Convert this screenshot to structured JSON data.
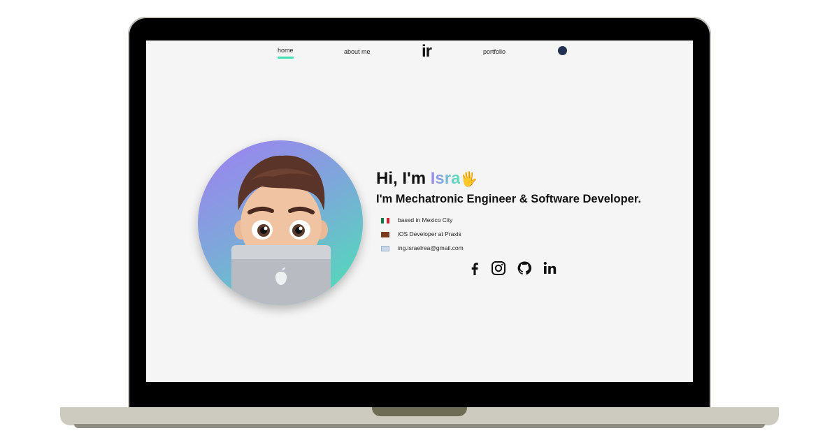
{
  "nav": {
    "items": [
      "home",
      "about me",
      "portfolio"
    ],
    "logo": "ir",
    "theme_toggle_icon": "dark-circle-icon"
  },
  "hero": {
    "greeting_prefix": "Hi, I'm ",
    "name": "Isra",
    "wave_emoji": "🖐",
    "subtitle": "I'm Mechatronic Engineer & Software Developer.",
    "info": [
      {
        "icon": "mexico-flag-icon",
        "text": "based in Mexico City"
      },
      {
        "icon": "briefcase-icon",
        "text": "iOS Developer at Praxis"
      },
      {
        "icon": "email-icon",
        "text": "ing.israelrea@gmail.com"
      }
    ],
    "socials": [
      "facebook-icon",
      "instagram-icon",
      "github-icon",
      "linkedin-icon"
    ]
  },
  "colors": {
    "accent_green": "#3fe0b0",
    "accent_purple": "#9a86f0",
    "theme_dot": "#24304f"
  }
}
